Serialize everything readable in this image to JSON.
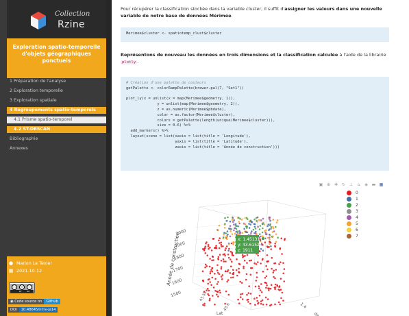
{
  "brand": {
    "prefix": "Collection",
    "name": "Rzine"
  },
  "book_title": "Exploration spatio-temporelle d'objets géographiques ponctuels",
  "toc": {
    "items": [
      "1 Préparation de l'analyse",
      "2 Exploration temporelle",
      "3 Exploration spatiale",
      "4 Regroupements spatio-temporels",
      "4.1 Prisme spatio-temporel",
      "4.2 ST-DBSCAN",
      "Bibliographie",
      "Annexes"
    ]
  },
  "author": {
    "name": "Marion Le Texier",
    "date": "2021-10-12"
  },
  "license": {
    "by": "BY",
    "sa": "SA"
  },
  "badges": {
    "code_label": "Code source on",
    "code_value": "Github",
    "doi_label": "DOI",
    "doi_value": "10.48645/nmv-ja14"
  },
  "content": {
    "p1_pre": "Pour récupérer la classification stockée dans la variable ",
    "p1_var": "cluster",
    "p1_mid": ", il suffit d'",
    "p1_bold": "assigner les valeurs dans une nouvelle variable de notre base de données Mérimée",
    "p1_end": ".",
    "code1": "Merimee$cluster <- spatiotemp_clust$cluster",
    "p2_pre": "Représentons de nouveau les données en trois dimensions et la classification calculée",
    "p2_mid": " à l'aide de la librairie ",
    "p2_lib": "plotly",
    "p2_end": ".",
    "code2": [
      {
        "cls": "comment",
        "text": "# Création d'une palette de couleurs"
      },
      {
        "cls": "",
        "text": "getPalette <- colorRampPalette(brewer.pal(7, \"Set1\"))"
      },
      {
        "cls": "",
        "text": ""
      },
      {
        "cls": "",
        "text": "plot_ly(x = unlist(x = map(Merimee$geometry, 1)),"
      },
      {
        "cls": "",
        "text": "              y = unlist(map(Merimee$geometry, 2)),"
      },
      {
        "cls": "",
        "text": "              z = as.numeric(Merimee$pbdate),"
      },
      {
        "cls": "",
        "text": "              color = as.factor(Merimee$cluster),"
      },
      {
        "cls": "",
        "text": "              colors = getPalette(length(unique(Merimee$cluster))),"
      },
      {
        "cls": "",
        "text": "              size = 0.6) %>%"
      },
      {
        "cls": "",
        "text": "  add_markers() %>%"
      },
      {
        "cls": "",
        "text": "  layout(scene = list(xaxis = list(title = 'Longitude'),"
      },
      {
        "cls": "",
        "text": "                      yaxis = list(title = 'Latitude'),"
      },
      {
        "cls": "",
        "text": "                      zaxis = list(title = 'Année de construction')))"
      }
    ]
  },
  "plot": {
    "toolbar_icons": [
      "camera-icon",
      "zoom-icon",
      "pan-icon",
      "orbit-icon",
      "turntable-icon",
      "reset-icon",
      "hover-icon",
      "spike-icon",
      "plotly-logo-icon"
    ],
    "tooltip": {
      "x": "x: 1.45131",
      "y": "y: 43.61521",
      "z": "z: 1911"
    },
    "zaxis_title": "Année de construction",
    "z_ticks": [
      "2000",
      "1900",
      "1800",
      "1700",
      "1600",
      "1500"
    ],
    "y_ticks": [
      "43.55",
      "43.6"
    ],
    "x_ticks": [
      "1.4"
    ],
    "x_title_partial": "de",
    "y_title_partial": "Lat"
  },
  "chart_data": {
    "type": "scatter",
    "dimensions": 3,
    "zlabel": "Année de construction",
    "z_ticks": [
      1500,
      1600,
      1700,
      1800,
      1900,
      2000
    ],
    "y_ticks": [
      43.55,
      43.6
    ],
    "x_ticks": [
      1.4
    ],
    "legend": {
      "placement": "right",
      "entries": [
        "0",
        "1",
        "2",
        "3",
        "4",
        "5",
        "6",
        "7"
      ]
    },
    "colors": [
      "#e41a1c",
      "#3f6ea8",
      "#4aa04a",
      "#8e8e8e",
      "#9f5fa8",
      "#f6a02d",
      "#f2d23c",
      "#a86437"
    ],
    "highlighted_point": {
      "x": 1.45131,
      "y": 43.61521,
      "z": 1911,
      "cluster": "2"
    }
  }
}
